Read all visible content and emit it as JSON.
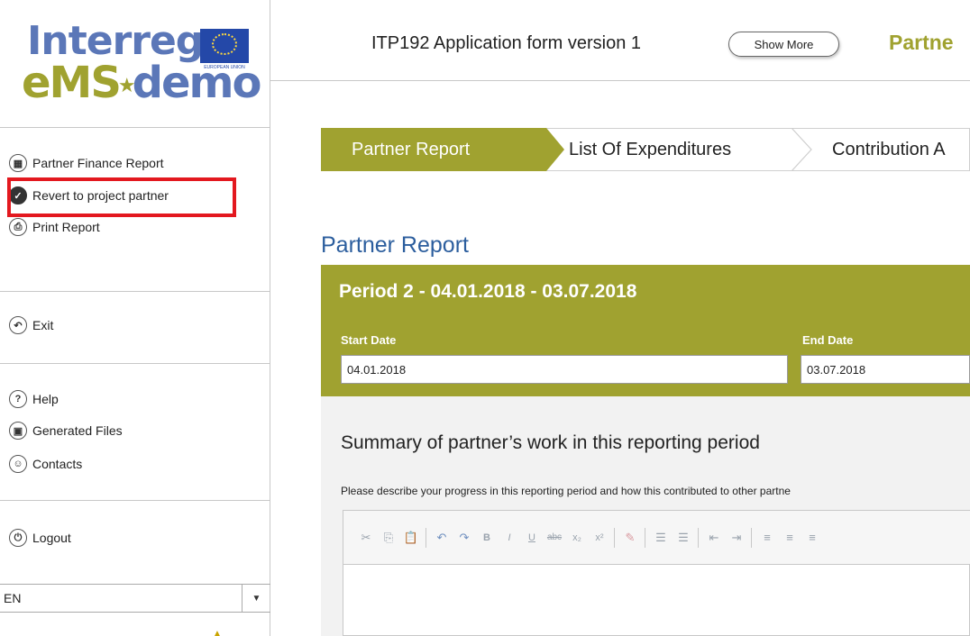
{
  "logo": {
    "line1": "Interreg",
    "line2a": "eMS",
    "line2b": "demo",
    "eu_caption": "EUROPEAN UNION"
  },
  "sidebar": {
    "actions": [
      {
        "label": "Partner Finance Report",
        "icon": "table-icon"
      },
      {
        "label": "Revert to project partner",
        "icon": "check-circle-icon"
      },
      {
        "label": "Print Report",
        "icon": "print-icon"
      }
    ],
    "exit": {
      "label": "Exit",
      "icon": "undo-icon"
    },
    "help_items": [
      {
        "label": "Help",
        "icon": "question-icon"
      },
      {
        "label": "Generated Files",
        "icon": "save-icon"
      },
      {
        "label": "Contacts",
        "icon": "user-icon"
      }
    ],
    "logout": {
      "label": "Logout",
      "icon": "power-icon"
    },
    "language": {
      "value": "EN"
    },
    "highlight_color": "#e3181f"
  },
  "header": {
    "title": "ITP192 Application form version 1",
    "show_more": "Show More",
    "partner_word": "Partne"
  },
  "wizard": {
    "steps": [
      {
        "label": "Partner Report",
        "active": true
      },
      {
        "label": "List Of Expenditures",
        "active": false
      },
      {
        "label": "Contribution A",
        "active": false
      }
    ]
  },
  "report": {
    "section_title": "Partner Report",
    "period_title": "Period 2 - 04.01.2018 - 03.07.2018",
    "start_date_label": "Start Date",
    "start_date": "04.01.2018",
    "end_date_label": "End Date",
    "end_date": "03.07.2018",
    "summary_title": "Summary of partner’s work in this reporting period",
    "summary_description": "Please describe your progress in this reporting period and how this contributed to other partne"
  },
  "colors": {
    "accent_olive": "#a0a230",
    "title_blue": "#2c5e9e",
    "logo_blue": "#5b77b8",
    "eu_blue": "#2448a8"
  }
}
